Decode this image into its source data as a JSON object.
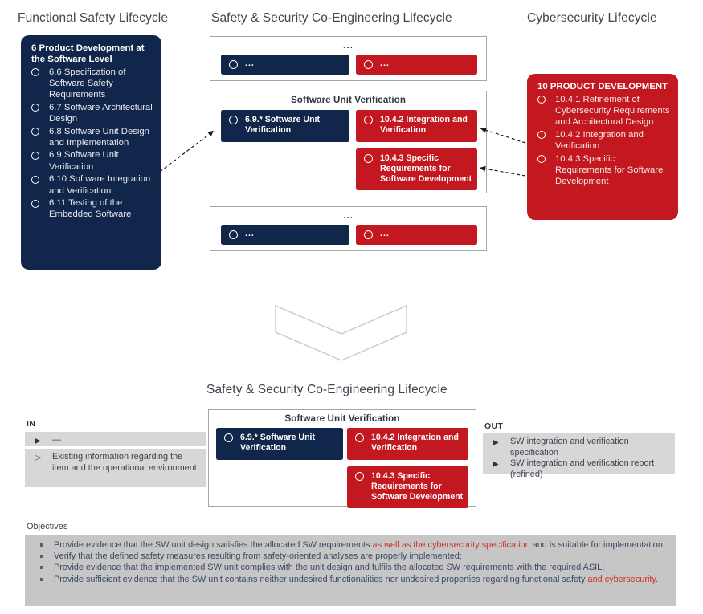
{
  "colors": {
    "navy": "#10264b",
    "red": "#c3181f",
    "highlight_red": "#d0312a",
    "frame_gray": "#a6a6a6",
    "panel_gray": "#d7d7d7",
    "objectives_gray": "#c6c6c6"
  },
  "columns": {
    "functional_safety_title": "Functional Safety Lifecycle",
    "co_engineering_title": "Safety & Security Co-Engineering Lifecycle",
    "cybersecurity_title": "Cybersecurity Lifecycle"
  },
  "functional_safety_card": {
    "title": "6 Product Development at the Software Level",
    "items": [
      "6.6 Specification of Software Safety Requirements",
      "6.7 Software Architectural Design",
      "6.8 Software Unit Design and Implementation",
      "6.9 Software Unit Verification",
      "6.10 Software Integration and Verification",
      "6.11 Testing of the Embedded Software"
    ]
  },
  "cybersecurity_card": {
    "title": "10 PRODUCT DEVELOPMENT",
    "items": [
      "10.4.1 Refinement of Cybersecurity Requirements and Architectural Design",
      "10.4.2 Integration and Verification",
      "10.4.3 Specific Requirements for Software Development"
    ]
  },
  "co_engineering": {
    "group_top": {
      "title": "...",
      "navy_block": "...",
      "red_block": "..."
    },
    "group_middle": {
      "title": "Software Unit Verification",
      "navy_block": "6.9.* Software Unit Verification",
      "red_block_1": "10.4.2 Integration and Verification",
      "red_block_2": "10.4.3 Specific Requirements for Software Development"
    },
    "group_bottom": {
      "title": "...",
      "navy_block": "...",
      "red_block": "..."
    }
  },
  "detail": {
    "title": "Safety & Security Co-Engineering Lifecycle",
    "group": {
      "title": "Software Unit Verification",
      "navy_block": "6.9.* Software Unit Verification",
      "red_block_1": "10.4.2 Integration and Verification",
      "red_block_2": "10.4.3 Specific Requirements for Software Development"
    },
    "in": {
      "label": "IN",
      "group_a": [
        {
          "marker": "▶",
          "text": "—"
        }
      ],
      "group_b": [
        {
          "marker": "▷",
          "text": "Existing information regarding the item and the operational environment"
        }
      ]
    },
    "out": {
      "label": "OUT",
      "items": [
        {
          "marker": "▶",
          "text": "SW integration and verification specification"
        },
        {
          "marker": "▶",
          "text": "SW integration and verification report (refined)"
        }
      ]
    }
  },
  "objectives": {
    "label": "Objectives",
    "items": [
      [
        {
          "t": "Provide evidence that the SW unit design satisfies the allocated SW requirements ",
          "hl": false
        },
        {
          "t": "as well as the cybersecurity specification",
          "hl": true
        },
        {
          "t": " and is suitable for implementation;",
          "hl": false
        }
      ],
      [
        {
          "t": "Verify that the defined safety measures resulting from safety-oriented analyses are properly implemented;",
          "hl": false
        }
      ],
      [
        {
          "t": "Provide evidence that the implemented SW unit complies with the unit design and fulfils the allocated SW requirements with the required ASIL;",
          "hl": false
        }
      ],
      [
        {
          "t": "Provide sufficient evidence that the SW unit contains neither undesired functionalities nor undesired properties regarding functional safety ",
          "hl": false
        },
        {
          "t": "and cybersecurity",
          "hl": true
        },
        {
          "t": ".",
          "hl": false
        }
      ]
    ]
  }
}
